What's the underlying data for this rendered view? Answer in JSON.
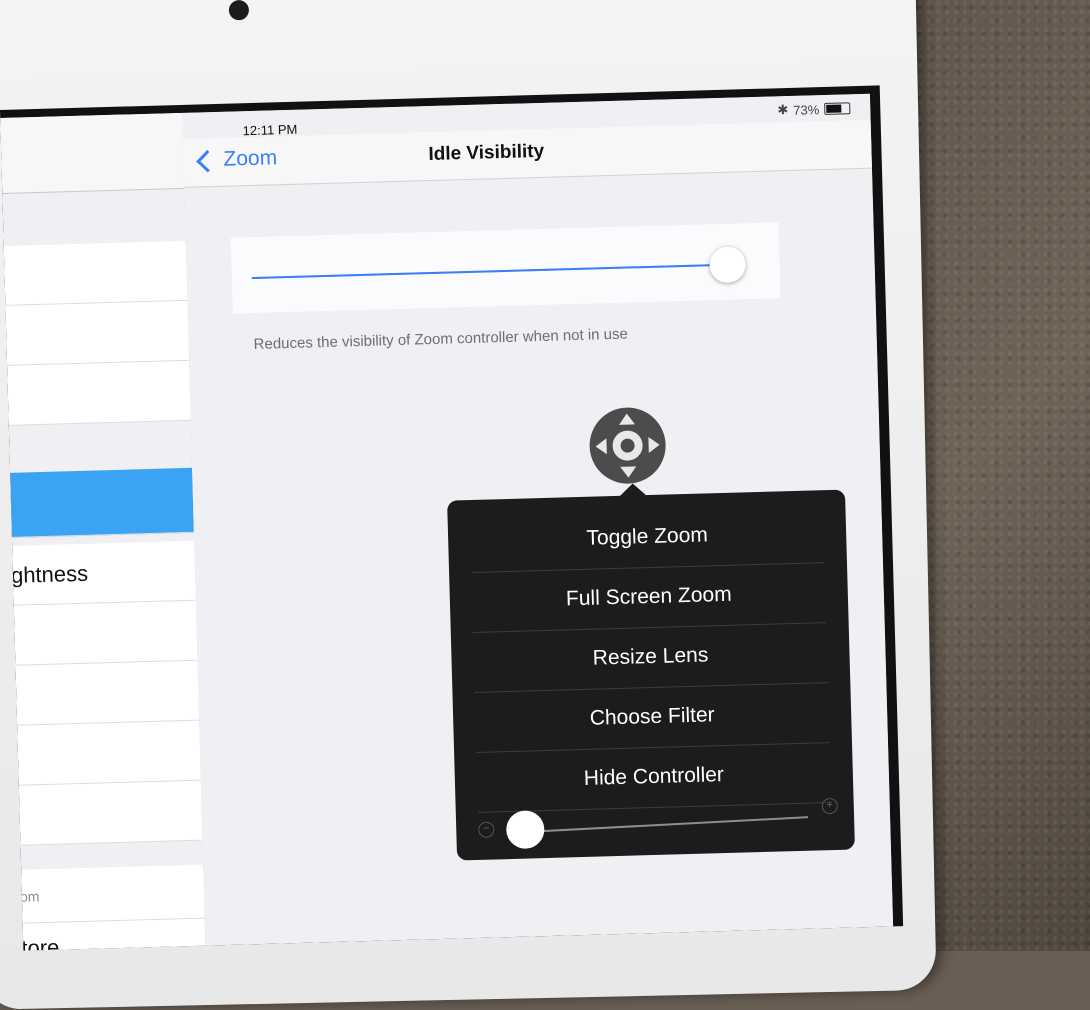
{
  "status_bar": {
    "time": "12:11 PM",
    "bluetooth_icon": "bluetooth-icon",
    "battery_text": "73%",
    "battery_level": 0.73
  },
  "master": {
    "rows": [
      {
        "label": ""
      },
      {
        "label": ""
      },
      {
        "label": ""
      },
      {
        "label": "",
        "selected": true
      },
      {
        "label": "ghtness"
      },
      {
        "label": ""
      },
      {
        "label": ""
      },
      {
        "label": ""
      },
      {
        "label": ""
      },
      {
        "label": "om",
        "small": true
      },
      {
        "label": "tore"
      }
    ]
  },
  "detail": {
    "back_label": "Zoom",
    "title": "Idle Visibility",
    "idle_visibility_level": 0.98,
    "footnote": "Reduces the visibility of Zoom controller when not in use"
  },
  "zoom_menu": {
    "items": [
      {
        "label": "Toggle Zoom"
      },
      {
        "label": "Full Screen Zoom"
      },
      {
        "label": "Resize Lens"
      },
      {
        "label": "Choose Filter"
      },
      {
        "label": "Hide Controller"
      }
    ],
    "zoom_level": 0.0,
    "minus_symbol": "−",
    "plus_symbol": "+"
  },
  "colors": {
    "accent": "#3a7ff6",
    "selected_row": "#3aa3f3",
    "popover_bg": "#1c1c1c"
  }
}
